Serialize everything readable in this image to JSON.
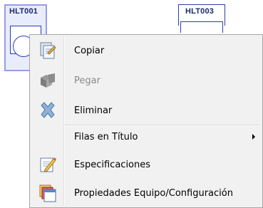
{
  "canvas": {
    "nodes": [
      {
        "id": "HLT001"
      },
      {
        "id": "HLT003"
      }
    ]
  },
  "context_menu": {
    "items": [
      {
        "label": "Copiar",
        "icon": "copy-icon",
        "enabled": true
      },
      {
        "label": "Pegar",
        "icon": "paste-icon",
        "enabled": false
      },
      {
        "label": "Eliminar",
        "icon": "delete-icon",
        "enabled": true
      },
      {
        "label": "Filas en Título",
        "icon": "",
        "enabled": true,
        "has_submenu": true
      },
      {
        "label": "Especificaciones",
        "icon": "specifications-icon",
        "enabled": true
      },
      {
        "label": "Propiedades Equipo/Configuración",
        "icon": "equipment-properties-icon",
        "enabled": true
      }
    ]
  },
  "colors": {
    "selection_border": "#9a9ce6",
    "node_stroke": "#2b3bb5",
    "menu_background": "#f1f1f1"
  }
}
